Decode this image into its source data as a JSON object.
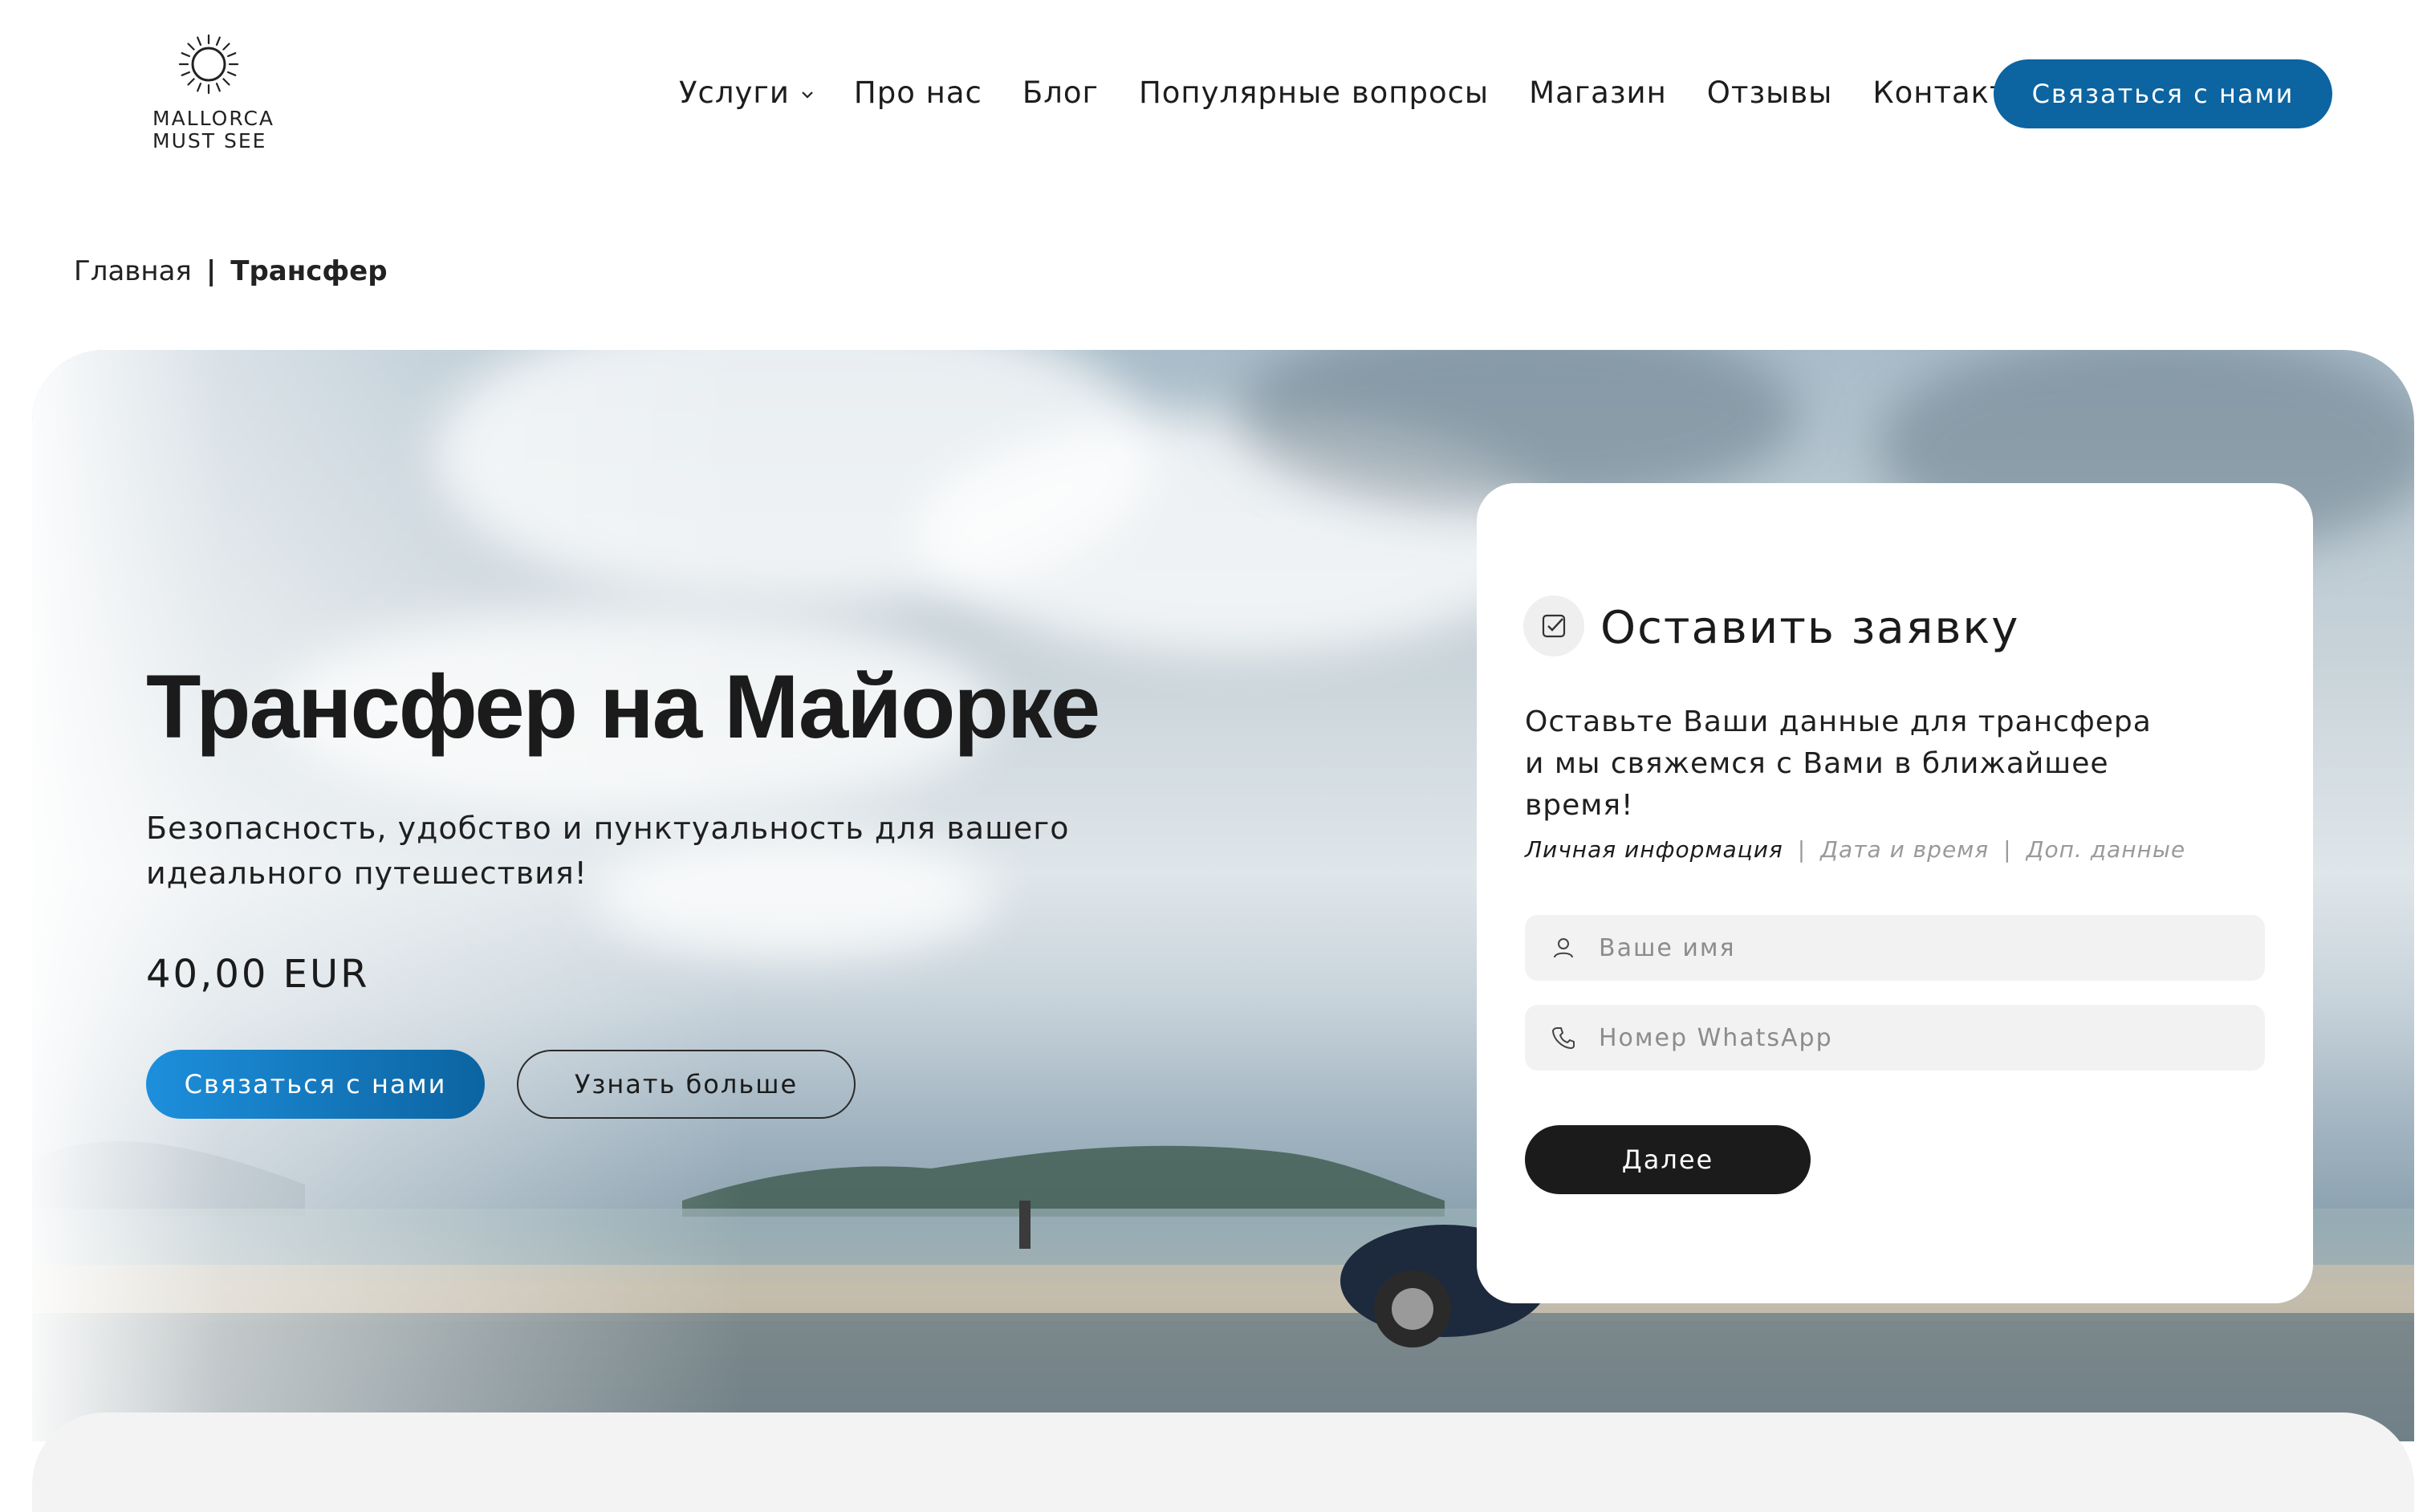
{
  "header": {
    "logo": {
      "line1": "MALLORCA",
      "line2": "MUST SEE"
    },
    "nav": [
      {
        "label": "Услуги",
        "has_dropdown": true
      },
      {
        "label": "Про нас"
      },
      {
        "label": "Блог"
      },
      {
        "label": "Популярные вопросы"
      },
      {
        "label": "Магазин"
      },
      {
        "label": "Отзывы"
      },
      {
        "label": "Контакты"
      }
    ],
    "cta_label": "Связаться с нами"
  },
  "breadcrumb": {
    "home": "Главная",
    "separator": "|",
    "current": "Трансфер"
  },
  "hero": {
    "title": "Трансфер на Майорке",
    "subtitle": "Безопасность, удобство и пунктуальность для вашего идеального путешествия!",
    "price": "40,00 EUR",
    "primary_button": "Связаться с нами",
    "secondary_button": "Узнать больше"
  },
  "form": {
    "icon": "checkbox-icon",
    "title": "Оставить заявку",
    "description": "Оставьте Ваши данные для трансфера и мы свяжемся с Вами в ближайшее время!",
    "steps": [
      {
        "label": "Личная информация",
        "active": true
      },
      {
        "label": "Дата и время",
        "active": false
      },
      {
        "label": "Доп. данные",
        "active": false
      }
    ],
    "step_separator": "|",
    "name_placeholder": "Ваше имя",
    "name_value": "",
    "phone_placeholder": "Номер WhatsApp",
    "phone_value": "",
    "next_button": "Далее"
  },
  "colors": {
    "brand_blue": "#0c64a1",
    "brand_blue_light": "#1d8fdc",
    "dark_button": "#1b1b1b",
    "field_bg": "#f2f2f2"
  }
}
